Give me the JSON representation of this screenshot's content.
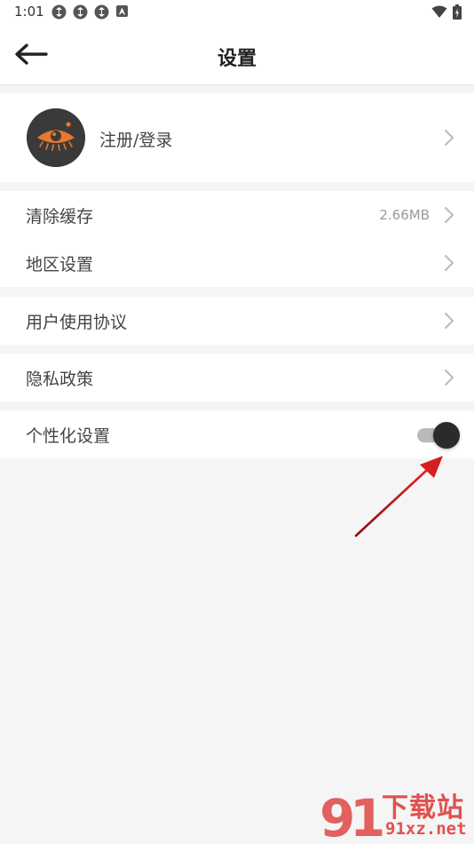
{
  "status_bar": {
    "time": "1:01",
    "left_icons": [
      "sync-icon",
      "sync-icon",
      "sync-icon",
      "app-badge-icon"
    ],
    "right_icons": [
      "wifi-icon",
      "battery-charging-icon"
    ]
  },
  "header": {
    "back_icon": "arrow-left-icon",
    "title": "设置"
  },
  "account": {
    "login_label": "注册/登录",
    "avatar_icon": "eye-logo-icon"
  },
  "settings": {
    "clear_cache": {
      "label": "清除缓存",
      "value": "2.66MB"
    },
    "region": {
      "label": "地区设置"
    },
    "user_agreement": {
      "label": "用户使用协议"
    },
    "privacy": {
      "label": "隐私政策"
    },
    "personalization": {
      "label": "个性化设置",
      "enabled": true
    }
  },
  "watermark": {
    "text": "下载站",
    "url": "91xz.net",
    "logo": "91"
  },
  "colors": {
    "background": "#f5f5f5",
    "card": "#ffffff",
    "accent_orange": "#e8782e",
    "annotation_red": "#d42020",
    "toggle_knob": "#2b2b2b"
  }
}
